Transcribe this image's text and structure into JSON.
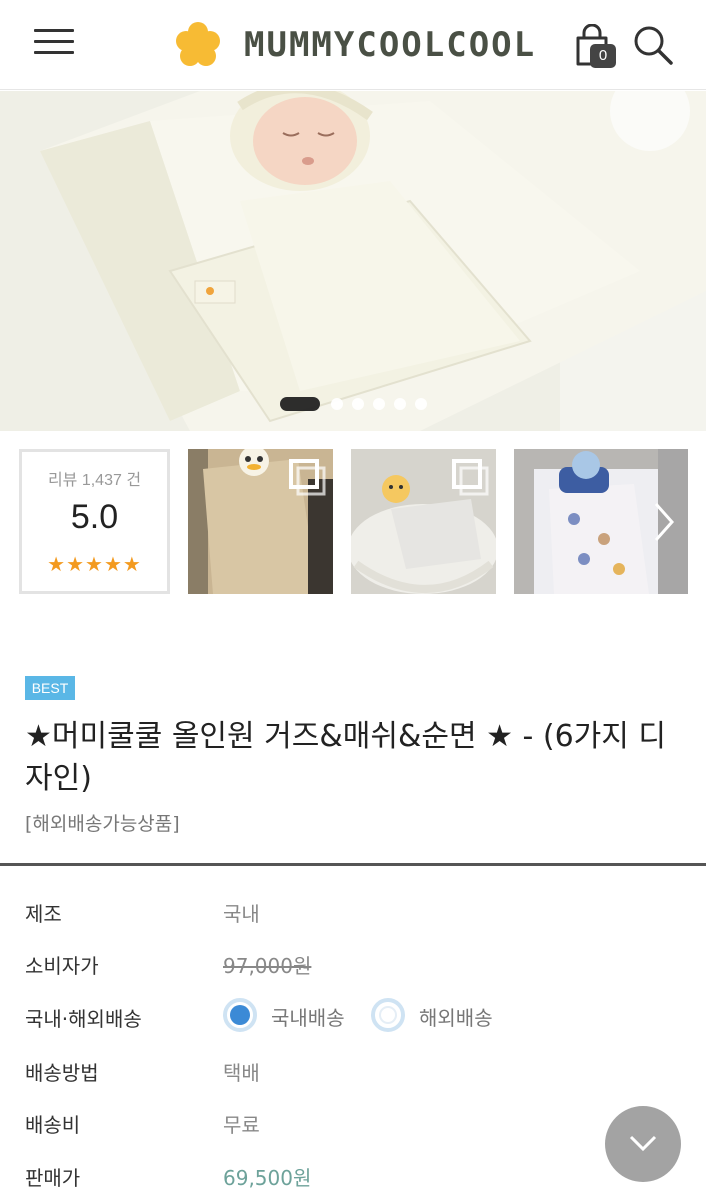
{
  "header": {
    "logo_text": "MUMMYCOOLCOOL",
    "cart_count": "0"
  },
  "hero": {
    "slide_count": 6,
    "active_slide": 1
  },
  "review": {
    "count_text": "리뷰 1,437 건",
    "score": "5.0",
    "stars": "★★★★★"
  },
  "product": {
    "badge": "BEST",
    "title": "★머미쿨쿨 올인원 거즈&매쉬&순면 ★ - (6가지 디자인)",
    "subtitle": "[해외배송가능상품]"
  },
  "details": {
    "manufacture_label": "제조",
    "manufacture_value": "국내",
    "retail_label": "소비자가",
    "retail_value": "97,000원",
    "shipping_region_label": "국내·해외배송",
    "option_domestic": "국내배송",
    "option_overseas": "해외배송",
    "shipping_method_label": "배송방법",
    "shipping_method_value": "택배",
    "shipping_fee_label": "배송비",
    "shipping_fee_value": "무료",
    "sale_price_label": "판매가",
    "sale_price_value": "69,500원"
  },
  "colors": {
    "accent_blue": "#3b8ad6",
    "badge_blue": "#5ab7e6",
    "price_green": "#6da29a",
    "star_orange": "#f39a1f",
    "logo_yellow": "#f7bb34"
  }
}
